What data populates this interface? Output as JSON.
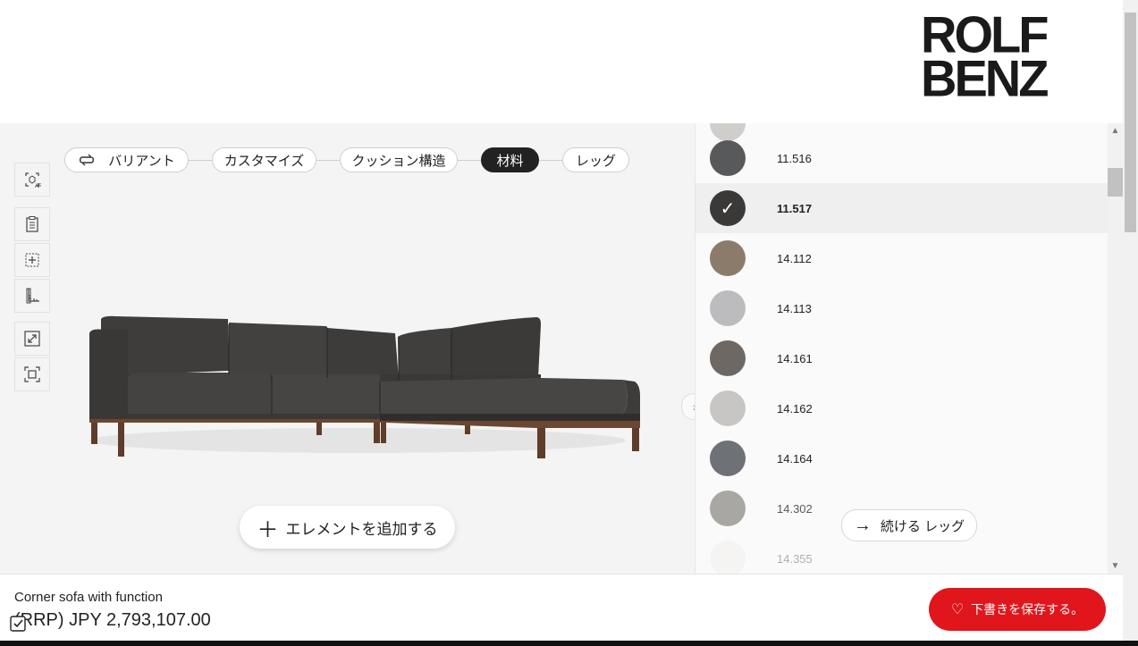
{
  "brand": {
    "line1": "ROLF",
    "line2": "BENZ"
  },
  "steps": [
    {
      "label": "バリアント",
      "active": false
    },
    {
      "label": "カスタマイズ",
      "active": false
    },
    {
      "label": "クッション構造",
      "active": false
    },
    {
      "label": "材料",
      "active": true
    },
    {
      "label": "レッグ",
      "active": false
    }
  ],
  "tools": [
    "ar-icon",
    "clipboard-icon",
    "add-element-icon",
    "measure-icon",
    "expand-icon",
    "fit-view-icon"
  ],
  "add_element_label": "エレメントを追加する",
  "materials": [
    {
      "code": "11.516",
      "color": "#58595a",
      "selected": false
    },
    {
      "code": "11.517",
      "color": "#3b3938",
      "selected": true
    },
    {
      "code": "14.112",
      "color": "#8b7b6a",
      "selected": false
    },
    {
      "code": "14.113",
      "color": "#bcbcbe",
      "selected": false
    },
    {
      "code": "14.161",
      "color": "#6d6864",
      "selected": false
    },
    {
      "code": "14.162",
      "color": "#c8c6c4",
      "selected": false
    },
    {
      "code": "14.164",
      "color": "#6e7176",
      "selected": false
    },
    {
      "code": "14.302",
      "color": "#8e8c88",
      "selected": false
    },
    {
      "code": "14.355",
      "color": "#ecebe6",
      "selected": false
    }
  ],
  "continue_label": "続ける レッグ",
  "product": {
    "name": "Corner sofa with function",
    "price": "(RRP) JPY 2,793,107.00"
  },
  "save_label": "下書きを保存する。",
  "colors": {
    "accent": "#e1151c",
    "active_step": "#222222"
  }
}
